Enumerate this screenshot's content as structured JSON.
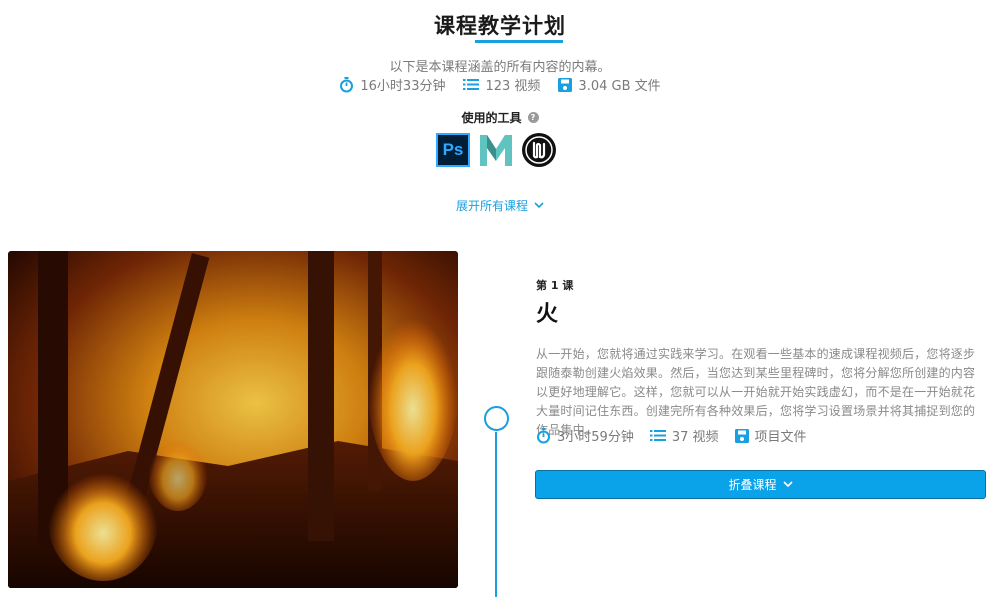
{
  "header": {
    "title": "课程教学计划",
    "subtitle": "以下是本课程涵盖的所有内容的内幕。",
    "stats": {
      "duration": "16小时33分钟",
      "videos": "123 视频",
      "files": "3.04 GB 文件"
    }
  },
  "tools": {
    "label": "使用的工具",
    "help_glyph": "?",
    "items": [
      {
        "name": "photoshop",
        "text": "Ps",
        "color": "#31a8ff"
      },
      {
        "name": "maya",
        "color": "#5fc4c0"
      },
      {
        "name": "unreal-engine",
        "color": "#111111"
      }
    ]
  },
  "expand_all_label": "展开所有课程",
  "lesson": {
    "number_label": "第 1 课",
    "title": "火",
    "description": "从一开始，您就将通过实践来学习。在观看一些基本的速成课程视频后，您将逐步跟随泰勒创建火焰效果。然后，当您达到某些里程碑时，您将分解您所创建的内容以更好地理解它。这样，您就可以从一开始就开始实践虚幻，而不是在一开始就花大量时间记住东西。创建完所有各种效果后，您将学习设置场景并将其捕捉到您的作品集中。",
    "stats": {
      "duration": "3小时59分钟",
      "videos": "37 视频",
      "files": "项目文件"
    },
    "collapse_label": "折叠课程"
  },
  "colors": {
    "accent": "#1a9fe0",
    "button": "#0aa3ea"
  }
}
